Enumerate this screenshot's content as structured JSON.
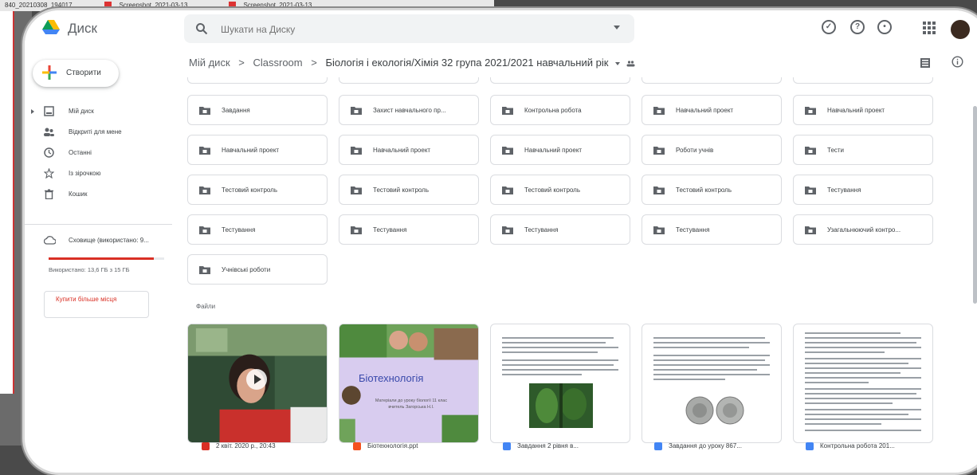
{
  "background": {
    "tab1": "840_20210308_194017",
    "tab2": "Screenshot_2021-03-13_...",
    "tab3": "Screenshot_2021-03-13_..."
  },
  "app": {
    "name": "Диск",
    "search_placeholder": "Шукати на Диску"
  },
  "sidebar": {
    "create_label": "Створити",
    "items": [
      {
        "label": "Мій диск",
        "icon": "drive-icon"
      },
      {
        "label": "Відкриті для мене",
        "icon": "shared-icon"
      },
      {
        "label": "Останні",
        "icon": "clock-icon"
      },
      {
        "label": "Із зірочкою",
        "icon": "star-icon"
      },
      {
        "label": "Кошик",
        "icon": "trash-icon"
      }
    ],
    "storage_label": "Сховище (використано: 9...",
    "storage_used_text": "Використано: 13,6 ГБ з 15 ГБ",
    "storage_fraction": 0.91,
    "buy_label": "Купити більше місця"
  },
  "breadcrumb": {
    "root": "Мій диск",
    "sep": ">",
    "level1": "Classroom",
    "current": "Біологія і екологія/Хімія 32 група 2021/2021 навчальний рік"
  },
  "folders": [
    "Завдання",
    "Захист навчального пр...",
    "Контрольна робота",
    "Навчальний проект",
    "Навчальний проект",
    "Навчальний проект",
    "Навчальний проект",
    "Навчальний проект",
    "Роботи учнів",
    "Тести",
    "Тестовий контроль",
    "Тестовий контроль",
    "Тестовий контроль",
    "Тестовий контроль",
    "Тестування",
    "Тестування",
    "Тестування",
    "Тестування",
    "Тестування",
    "Узагальнюючий контро...",
    "Учнівські роботи"
  ],
  "files_label": "Файли",
  "files": [
    {
      "caption": "2 квіт. 2020 р., 20:43",
      "icon_color": "#d93025"
    },
    {
      "caption": "Біотехнологія.ppt",
      "icon_color": "#f4511e",
      "thumb_title": "Біотехнологія",
      "thumb_sub": "Матеріали до уроку біології 11 клас вчитель Загорська Н.І."
    },
    {
      "caption": "Завдання 2 рівня в...",
      "icon_color": "#4285f4"
    },
    {
      "caption": "Завдання до уроку 867...",
      "icon_color": "#4285f4"
    },
    {
      "caption": "Контрольна робота 201...",
      "icon_color": "#4285f4"
    }
  ],
  "colors": {
    "accent_red": "#d93025",
    "folder_icon": "#5f6368",
    "text": "#3c4043"
  }
}
